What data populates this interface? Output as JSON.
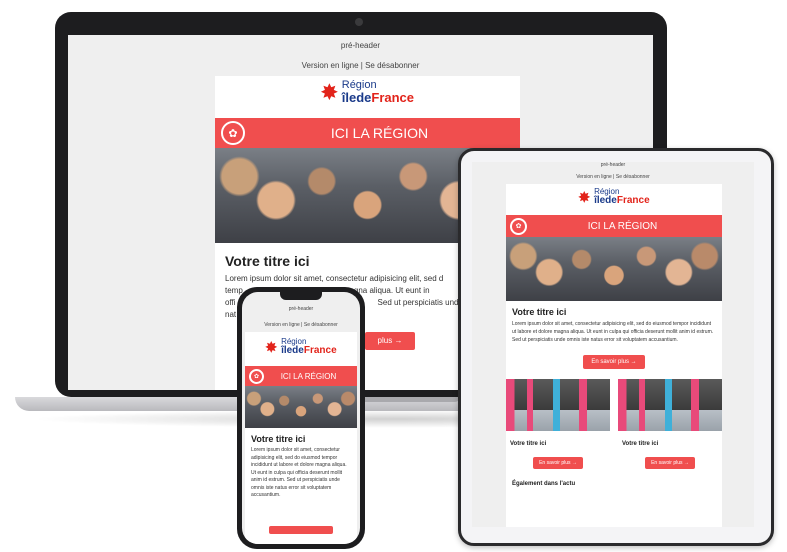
{
  "email": {
    "preheader": "pré-header",
    "top_links": "Version en ligne | Se désabonner",
    "logo_line1": "Région",
    "logo_line2_a": "îlede",
    "logo_line2_b": "France",
    "banner_title": "ICI LA RÉGION",
    "article_title": "Votre titre ici",
    "article_text": "Lorem ipsum dolor sit amet, consectetur adipisicing elit, sed do eiusmod tempor incididunt ut labore et dolore magna aliqua. Ut eunt in culpa qui officia deserunt mollit anim id estrum. Sed ut perspiciatis unde omnis iste natus error sit voluptatem accusantium.",
    "laptop_text_frag": "Lorem ipsum dolor sit amet, consectetur adipisicing elit, sed d",
    "laptop_text_frag2": "temp",
    "laptop_text_frag3": "magna aliqua. Ut eunt in",
    "laptop_text_frag4": "offi",
    "laptop_text_frag5": "Sed ut perspiciatis und",
    "laptop_text_frag6": "nat",
    "cta": "En savoir plus →",
    "laptop_cta_frag": "plus →",
    "col1_title": "Votre titre ici",
    "col2_title": "Votre titre ici",
    "col_cta": "En savoir plus →",
    "also_title": "Également dans l'actu"
  },
  "colors": {
    "accent": "#f04e4e",
    "logo_red": "#e2231a",
    "logo_blue": "#1a3a8a"
  },
  "icons": [
    "camera-icon",
    "star-logo-icon",
    "banner-circle-icon"
  ]
}
